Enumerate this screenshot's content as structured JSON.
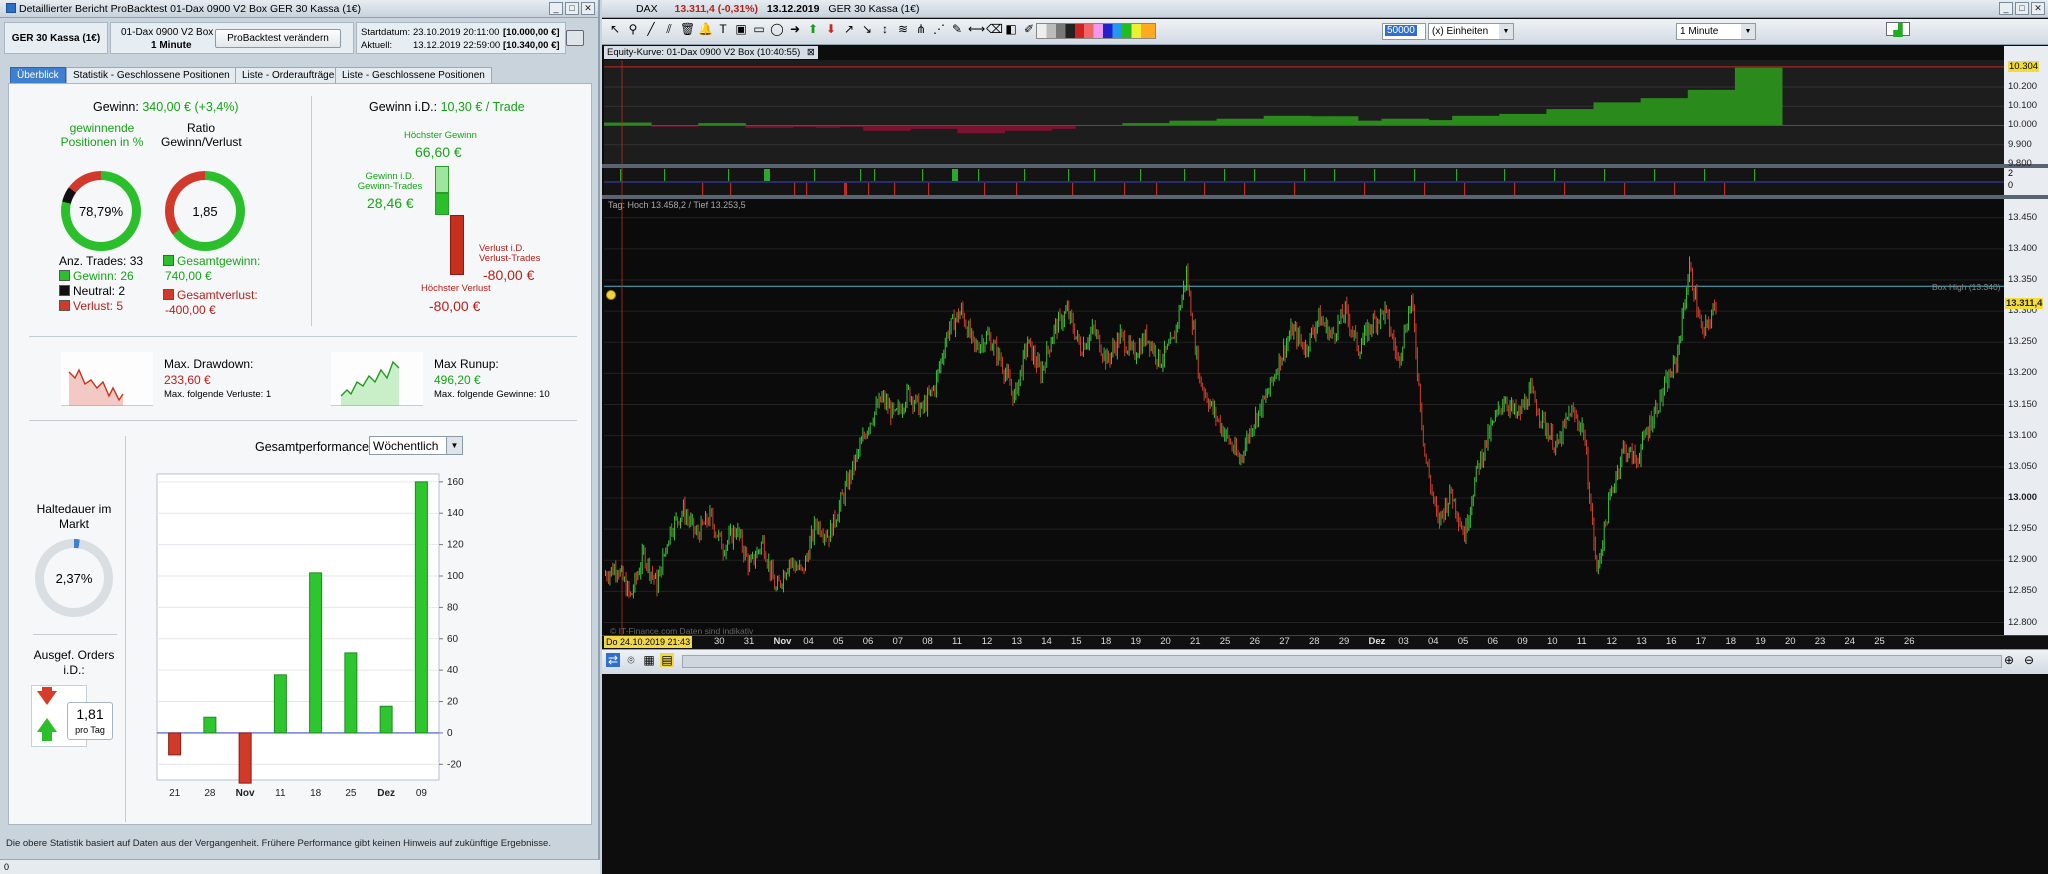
{
  "left_window": {
    "title": "Detaillierter Bericht   ProBacktest   01-Dax 0900  V2 Box   GER 30 Kassa (1€)",
    "instrument_label": "GER 30 Kassa (1€)",
    "strategy_name": "01-Dax 0900  V2 Box",
    "timeframe": "1 Minute",
    "modify_button": "ProBacktest verändern",
    "start_label": "Startdatum:",
    "start_value": "23.10.2019 20:11:00",
    "start_capital": "[10.000,00 €]",
    "current_label": "Aktuell:",
    "current_value": "13.12.2019 22:59:00",
    "current_capital": "[10.340,00 €]",
    "tabs": [
      "Überblick",
      "Statistik - Geschlossene Positionen",
      "Liste - Orderaufträge",
      "Liste - Geschlossene Positionen"
    ],
    "gain_label": "Gewinn:",
    "gain_value": "340,00 € (+3,4%)",
    "winning_label": "gewinnende Positionen in %",
    "winning_value": "78,79%",
    "ratio_label": "Ratio Gewinn/Verlust",
    "ratio_value": "1,85",
    "trades_label": "Anz. Trades:",
    "trades_value": "33",
    "legend_gain": "Gewinn: 26",
    "legend_neutral": "Neutral: 2",
    "legend_loss": "Verlust: 5",
    "total_gain_label": "Gesamtgewinn:",
    "total_gain_value": "740,00 €",
    "total_loss_label": "Gesamtverlust:",
    "total_loss_value": "-400,00 €",
    "gain_id_label": "Gewinn i.D.:",
    "gain_id_value": "10,30 € / Trade",
    "highest_gain_label": "Höchster Gewinn",
    "highest_gain_value": "66,60 €",
    "gain_id_trades_label": "Gewinn i.D. Gewinn-Trades",
    "gain_id_trades_value": "28,46 €",
    "loss_id_trades_label": "Verlust i.D. Verlust-Trades",
    "loss_id_trades_value": "-80,00 €",
    "highest_loss_label": "Höchster Verlust",
    "highest_loss_value": "-80,00 €",
    "drawdown_label": "Max. Drawdown:",
    "drawdown_value": "233,60 €",
    "drawdown_sub": "Max. folgende Verluste: 1",
    "runup_label": "Max Runup:",
    "runup_value": "496,20 €",
    "runup_sub": "Max. folgende Gewinne: 10",
    "hold_label": "Haltedauer im Markt",
    "hold_value": "2,37%",
    "orders_label": "Ausgef. Orders i.D.:",
    "orders_value": "1,81",
    "orders_unit": "pro Tag",
    "perf_label": "Gesamtperformance",
    "perf_select": "Wöchentlich",
    "footer": "Die obere Statistik basiert auf Daten aus der Vergangenheit. Frühere Performance gibt keinen Hinweis auf zukünftige Ergebnisse."
  },
  "chart_data": {
    "type": "bar",
    "categories": [
      "21",
      "28",
      "Nov",
      "11",
      "18",
      "25",
      "Dez",
      "09"
    ],
    "values": [
      -14,
      10,
      -32,
      37,
      102,
      51,
      17,
      160
    ],
    "ylim": [
      -30,
      165
    ],
    "yticks": [
      -20,
      0,
      20,
      40,
      60,
      80,
      100,
      120,
      140,
      160
    ],
    "positive_color": "#2ec62e",
    "negative_color": "#d03a2a"
  },
  "right_window": {
    "symbol": "DAX",
    "price": "13.311,4 (-0,31%)",
    "date": "13.12.2019",
    "instrument": "GER 30 Kassa (1€)",
    "units_value": "50000",
    "units_label": "(x) Einheiten",
    "timeframe": "1 Minute",
    "equity_title": "Equity-Kurve: 01-Dax 0900  V2 Box (10:40:55)",
    "equity_yticks": [
      "10.304",
      "10.200",
      "10.100",
      "10.000",
      "9.900",
      "9.800"
    ],
    "equity_last": "10.304",
    "pos_yticks": [
      "2",
      "0"
    ],
    "price_header": "Tag: Hoch 13.458,2 / Tief 13.253,5",
    "price_yticks": [
      "13.450",
      "13.400",
      "13.350",
      "13.300",
      "13.250",
      "13.200",
      "13.150",
      "13.100",
      "13.050",
      "13.000",
      "12.950",
      "12.900",
      "12.850",
      "12.800"
    ],
    "last_price": "13.311,4",
    "box_high_label": "Box High (13.340)",
    "watermark": "© IT-Finance.com  Daten sind indikativ",
    "cursor_date": "Do 24.10.2019 21:43",
    "xticks": [
      "30",
      "31",
      "Nov",
      "04",
      "05",
      "06",
      "07",
      "08",
      "11",
      "12",
      "13",
      "14",
      "15",
      "18",
      "19",
      "20",
      "21",
      "25",
      "26",
      "27",
      "28",
      "29",
      "Dez",
      "03",
      "04",
      "05",
      "06",
      "09",
      "10",
      "11",
      "12",
      "13",
      "16",
      "17",
      "18",
      "19",
      "20",
      "23",
      "24",
      "25",
      "26"
    ],
    "price_series": [
      12.876,
      12.89,
      12.84,
      12.91,
      12.86,
      12.95,
      12.98,
      12.94,
      12.97,
      12.92,
      12.95,
      12.89,
      12.93,
      12.85,
      12.9,
      12.88,
      12.96,
      12.94,
      13.0,
      13.06,
      13.12,
      13.16,
      13.13,
      13.17,
      13.14,
      13.18,
      13.27,
      13.3,
      13.24,
      13.26,
      13.22,
      13.16,
      13.25,
      13.2,
      13.27,
      13.3,
      13.24,
      13.27,
      13.22,
      13.26,
      13.23,
      13.26,
      13.22,
      13.25,
      13.36,
      13.19,
      13.14,
      13.1,
      13.06,
      13.12,
      13.16,
      13.22,
      13.27,
      13.24,
      13.29,
      13.26,
      13.3,
      13.24,
      13.28,
      13.3,
      13.22,
      13.32,
      13.07,
      12.96,
      13.01,
      12.94,
      13.05,
      13.11,
      13.16,
      13.13,
      13.17,
      13.12,
      13.08,
      13.14,
      13.11,
      12.88,
      13.0,
      13.08,
      13.06,
      13.12,
      13.17,
      13.22,
      13.37,
      13.26,
      13.31
    ]
  }
}
